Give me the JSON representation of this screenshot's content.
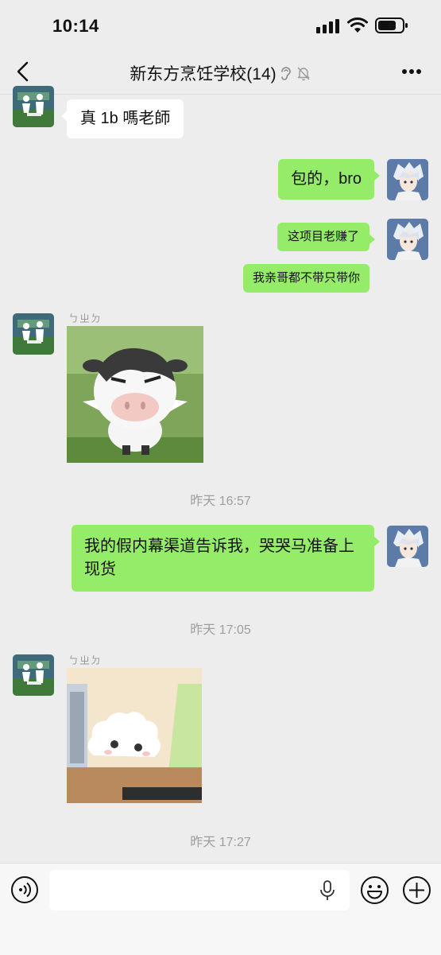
{
  "status_bar": {
    "time": "10:14"
  },
  "header": {
    "title": "新东方烹饪学校(14)"
  },
  "messages": {
    "m1_text": "真 1b 嗎老師",
    "m2_text": "包的，bro",
    "m3_text": "这项目老赚了",
    "m4_text": "我亲哥都不带只带你",
    "m5_sender": "ㄅㄓㄉ",
    "ts1": "昨天 16:57",
    "m6_text": "我的假内幕渠道告诉我，哭哭马准备上现货",
    "ts2": "昨天 17:05",
    "m7_sender": "ㄅㄓㄉ",
    "ts3": "昨天 17:27"
  },
  "input_bar": {
    "placeholder": ""
  },
  "colors": {
    "background": "#EDEDED",
    "bubble_self": "#95EC69",
    "bubble_other": "#FFFFFF"
  },
  "icons": [
    "back-arrow-icon",
    "ear-icon",
    "mute-bell-icon",
    "more-icon",
    "voice-icon",
    "mic-icon",
    "emoji-icon",
    "plus-icon"
  ]
}
